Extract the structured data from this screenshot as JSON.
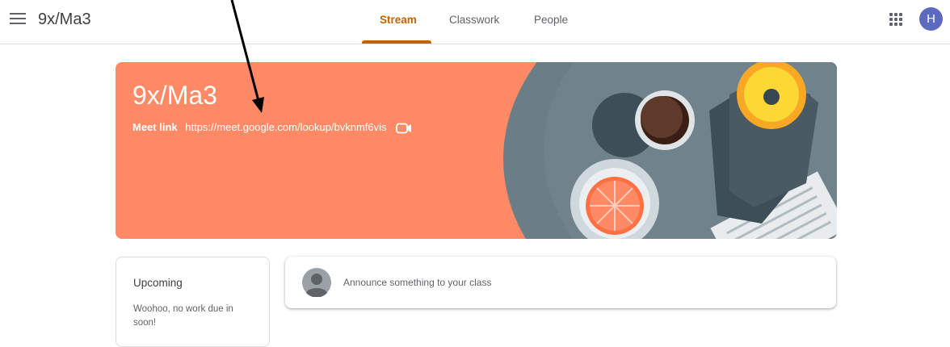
{
  "header": {
    "class_name": "9x/Ma3",
    "tabs": [
      {
        "label": "Stream",
        "active": true
      },
      {
        "label": "Classwork",
        "active": false
      },
      {
        "label": "People",
        "active": false
      }
    ],
    "avatar_initial": "H"
  },
  "banner": {
    "title": "9x/Ma3",
    "meet_label": "Meet link",
    "meet_url": "https://meet.google.com/lookup/bvknmf6vis",
    "color": "#ff8a65"
  },
  "upcoming": {
    "title": "Upcoming",
    "text": "Woohoo, no work due in soon!"
  },
  "announce": {
    "placeholder": "Announce something to your class"
  },
  "colors": {
    "accent": "#c26401",
    "avatar": "#5c6bc0"
  },
  "icons": [
    "menu-icon",
    "apps-grid-icon",
    "video-camera-icon",
    "person-avatar-icon"
  ]
}
